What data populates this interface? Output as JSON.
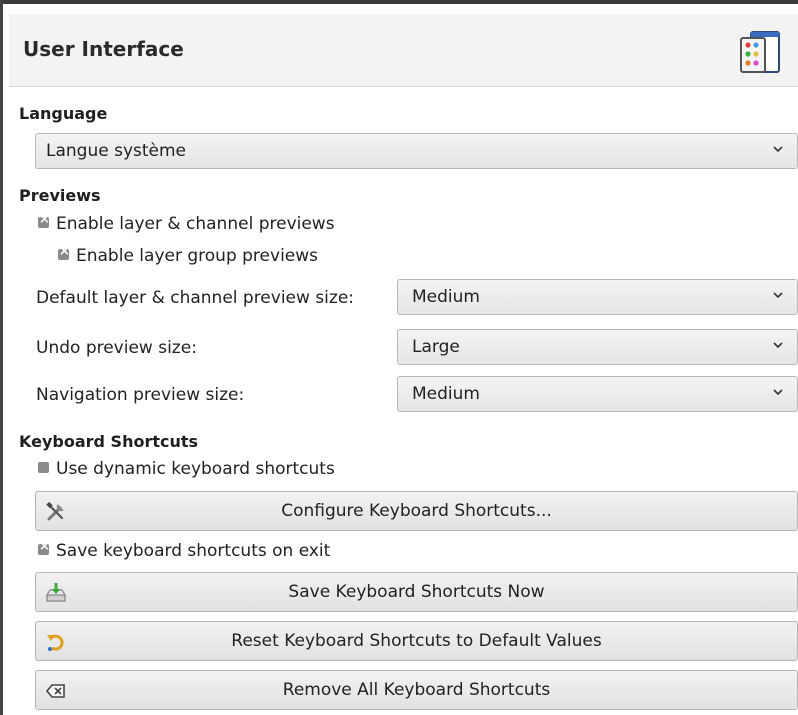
{
  "header": {
    "title": "User Interface",
    "icon": "user-interface-prefs-icon"
  },
  "language": {
    "section_title": "Language",
    "selected": "Langue système"
  },
  "previews": {
    "section_title": "Previews",
    "enable_layer_channel": {
      "label": "Enable layer & channel previews",
      "checked": true
    },
    "enable_layer_group": {
      "label": "Enable layer group previews",
      "checked": true
    },
    "default_size": {
      "label": "Default layer & channel preview size:",
      "value": "Medium"
    },
    "undo_size": {
      "label": "Undo preview size:",
      "value": "Large"
    },
    "navigation_size": {
      "label": "Navigation preview size:",
      "value": "Medium"
    }
  },
  "shortcuts": {
    "section_title": "Keyboard Shortcuts",
    "dynamic": {
      "label": "Use dynamic keyboard shortcuts",
      "checked": false
    },
    "configure_button": "Configure Keyboard Shortcuts...",
    "save_on_exit": {
      "label": "Save keyboard shortcuts on exit",
      "checked": true
    },
    "save_now_button": "Save Keyboard Shortcuts Now",
    "reset_button": "Reset Keyboard Shortcuts to Default Values",
    "remove_button": "Remove All Keyboard Shortcuts"
  },
  "icons": {
    "configure": "tools-icon",
    "save": "save-download-icon",
    "reset": "reset-undo-icon",
    "remove": "clear-backspace-icon"
  }
}
